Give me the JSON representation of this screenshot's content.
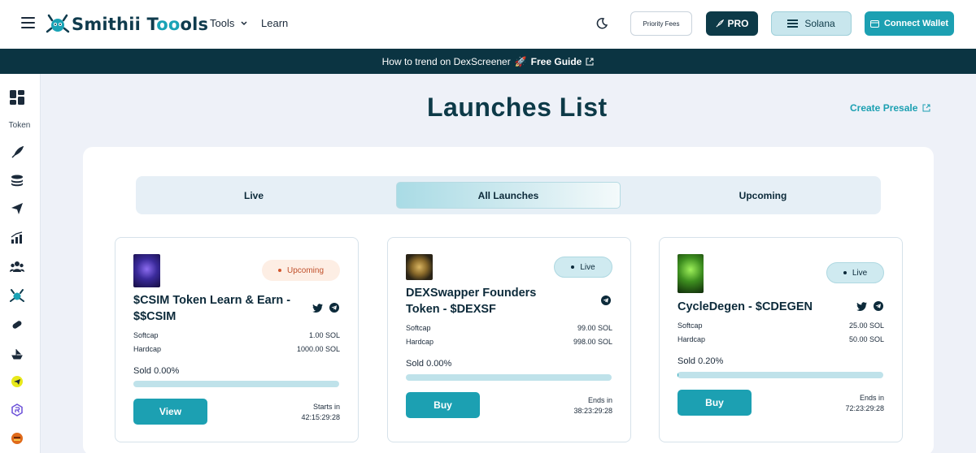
{
  "header": {
    "logo_text_a": "Smithii T",
    "logo_text_b": "o",
    "logo_text_c": "ols",
    "nav_tools": "Tools",
    "nav_learn": "Learn",
    "priority_fees": "Priority Fees",
    "pro": "PRO",
    "network": "Solana",
    "connect_wallet": "Connect Wallet"
  },
  "banner": {
    "text": "How to trend on DexScreener",
    "emoji": "🚀",
    "link": "Free Guide"
  },
  "sidebar": {
    "section_label": "Token",
    "icons": [
      "dashboard-icon",
      "rocket-icon",
      "coins-stack-icon",
      "send-icon",
      "chart-bars-icon",
      "users-icon",
      "smithii-icon",
      "pill-icon",
      "boat-icon",
      "telegram-bot-icon",
      "raydium-icon",
      "burger-icon"
    ]
  },
  "main": {
    "title": "Launches List",
    "create_presale": "Create Presale",
    "tabs": [
      {
        "label": "Live"
      },
      {
        "label": "All Launches"
      },
      {
        "label": "Upcoming"
      }
    ],
    "active_tab": "All Launches"
  },
  "cards": [
    {
      "status": "Upcoming",
      "title": "$CSIM Token Learn & Earn - $$CSIM",
      "softcap_label": "Softcap",
      "softcap": "1.00 SOL",
      "hardcap_label": "Hardcap",
      "hardcap": "1000.00 SOL",
      "sold": "Sold 0.00%",
      "sold_fraction": 0.0,
      "button": "View",
      "time_label": "Starts in",
      "time_value": "42:15:29:28",
      "socials": [
        "twitter-icon",
        "telegram-icon"
      ],
      "image_colors": [
        "#2a1a6e",
        "#8c6cf0"
      ]
    },
    {
      "status": "Live",
      "title": "DEXSwapper Founders Token - $DEXSF",
      "softcap_label": "Softcap",
      "softcap": "99.00 SOL",
      "hardcap_label": "Hardcap",
      "hardcap": "998.00 SOL",
      "sold": "Sold 0.00%",
      "sold_fraction": 0.0,
      "button": "Buy",
      "time_label": "Ends in",
      "time_value": "38:23:29:28",
      "socials": [
        "telegram-icon"
      ],
      "image_colors": [
        "#2b2416",
        "#c9a14a"
      ]
    },
    {
      "status": "Live",
      "title": "CycleDegen - $CDEGEN",
      "softcap_label": "Softcap",
      "softcap": "25.00 SOL",
      "hardcap_label": "Hardcap",
      "hardcap": "50.00 SOL",
      "sold": "Sold 0.20%",
      "sold_fraction": 0.002,
      "button": "Buy",
      "time_label": "Ends in",
      "time_value": "72:23:29:28",
      "socials": [
        "twitter-icon",
        "telegram-icon"
      ],
      "image_colors": [
        "#0f2a0a",
        "#6fd33a"
      ]
    }
  ],
  "colors": {
    "accent": "#1ca0b2",
    "dark": "#0b3442",
    "upcoming": "#c0502b"
  }
}
